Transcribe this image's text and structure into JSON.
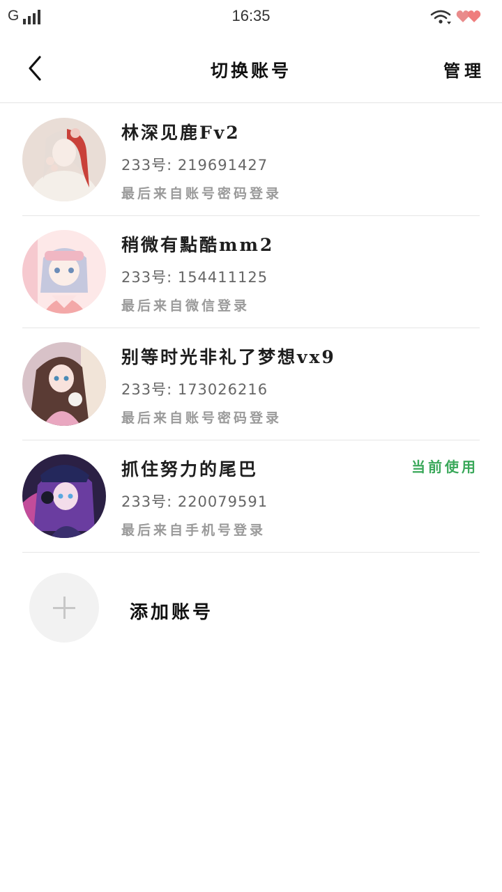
{
  "status_bar": {
    "carrier": "G",
    "time": "16:35",
    "icons": [
      "signal-icon",
      "wifi-icon",
      "heart-icon"
    ]
  },
  "nav": {
    "title": "切换账号",
    "manage_label": "管理",
    "back_icon": "chevron-left-icon"
  },
  "accounts": [
    {
      "name": "林深见鹿Fv2",
      "id_line": "233号: 219691427",
      "login": "最后来自账号密码登录",
      "avatar_colors": [
        "#e9ddd6",
        "#c9413a",
        "#f4efe9"
      ]
    },
    {
      "name": "稍微有點酷mm2",
      "id_line": "233号: 154411125",
      "login": "最后来自微信登录",
      "avatar_colors": [
        "#f6c9cf",
        "#c5c8de",
        "#fde8e8"
      ]
    },
    {
      "name": "别等时光非礼了梦想vx9",
      "id_line": "233号: 173026216",
      "login": "最后来自账号密码登录",
      "avatar_colors": [
        "#d8c2c8",
        "#5a3b34",
        "#e9a7c0"
      ]
    },
    {
      "name": "抓住努力的尾巴",
      "id_line": "233号: 220079591",
      "login": "最后来自手机号登录",
      "current_label": "当前使用",
      "avatar_colors": [
        "#2b2044",
        "#6a3da0",
        "#c24c9a"
      ]
    }
  ],
  "add_account": {
    "label": "添加账号",
    "icon": "plus-icon"
  },
  "colors": {
    "current_green": "#3aa85a",
    "divider": "#e6e6e6",
    "secondary_text": "#9a9a9a"
  }
}
